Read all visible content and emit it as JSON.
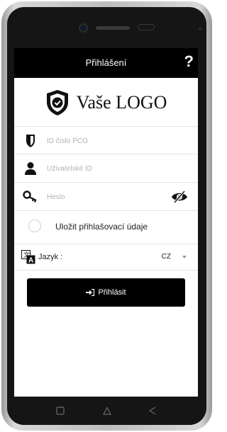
{
  "app_bar": {
    "title": "Přihlášení",
    "help": "?"
  },
  "logo": {
    "text": "Vaše LOGO"
  },
  "fields": {
    "pco": {
      "placeholder": "ID číslo PCO",
      "value": ""
    },
    "user": {
      "placeholder": "Uživatelské ID",
      "value": ""
    },
    "password": {
      "placeholder": "Heslo",
      "value": ""
    }
  },
  "save_credentials": {
    "label": "Uložit přihlašovací údaje",
    "checked": false
  },
  "language": {
    "label": "Jazyk :",
    "value": "CZ"
  },
  "login_button": {
    "label": "Přihlásit"
  },
  "icons": {
    "pco": "shield-icon",
    "user": "user-icon",
    "password": "key-icon",
    "show_password": "eye-icon",
    "language": "translate-icon",
    "login": "sign-in-icon",
    "logo": "shield-check-icon"
  },
  "colors": {
    "bar": "#000000",
    "button": "#000000",
    "button_text": "#ffffff"
  }
}
